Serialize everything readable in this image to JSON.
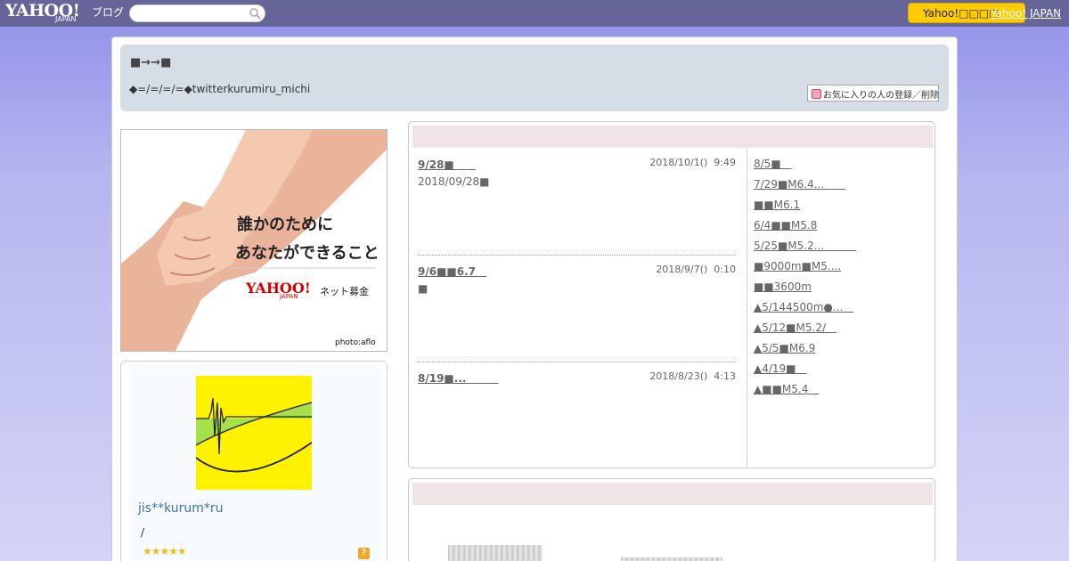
{
  "header": {
    "logo": "YAHOO!",
    "logo_sub": "JAPAN",
    "blog_label": "ブログ",
    "search_placeholder": "",
    "yahoo_button": "Yahoo!□□□□",
    "yahoo_japan_link": "Yahoo! JAPAN"
  },
  "blog": {
    "title": "■→→■",
    "description": "◆=/=/=/=◆twitterkurumiru_michi",
    "fav_button": "お気に入りの人の登録／削除"
  },
  "ad": {
    "line1": "誰かのために",
    "line2": "あなたができること",
    "logo": "YAHOO!",
    "logo_sub": "JAPAN",
    "service": "ネット募金",
    "credit": "photo:aflo"
  },
  "profile": {
    "name": "jis**kurum*ru",
    "note": "/",
    "stars": "★★★★★",
    "help": "?"
  },
  "articles": [
    {
      "title": "9/28■　　",
      "date": "2018/10/1()  9:49",
      "body": "2018/09/28■"
    },
    {
      "title": "9/6■■6.7　",
      "date": "2018/9/7()  0:10",
      "body": "■"
    },
    {
      "title": "8/19■...　　　",
      "date": "2018/8/23()  4:13",
      "body": ""
    }
  ],
  "recent": [
    "8/5■　",
    "7/29■M6.4...　　",
    "■■M6.1",
    "6/4■■M5.8",
    "5/25■M5.2...　　　",
    "■9000m■M5....",
    "■■3600m",
    "▲5/144500m●...　",
    "▲5/12■M5.2/　",
    "▲5/5■M6.9",
    "▲4/19■　",
    "▲■■M5.4　"
  ],
  "colors": {
    "header_bg": "#656599",
    "accent_button": "#ffcc00",
    "link_blue": "#3b6fb8"
  }
}
